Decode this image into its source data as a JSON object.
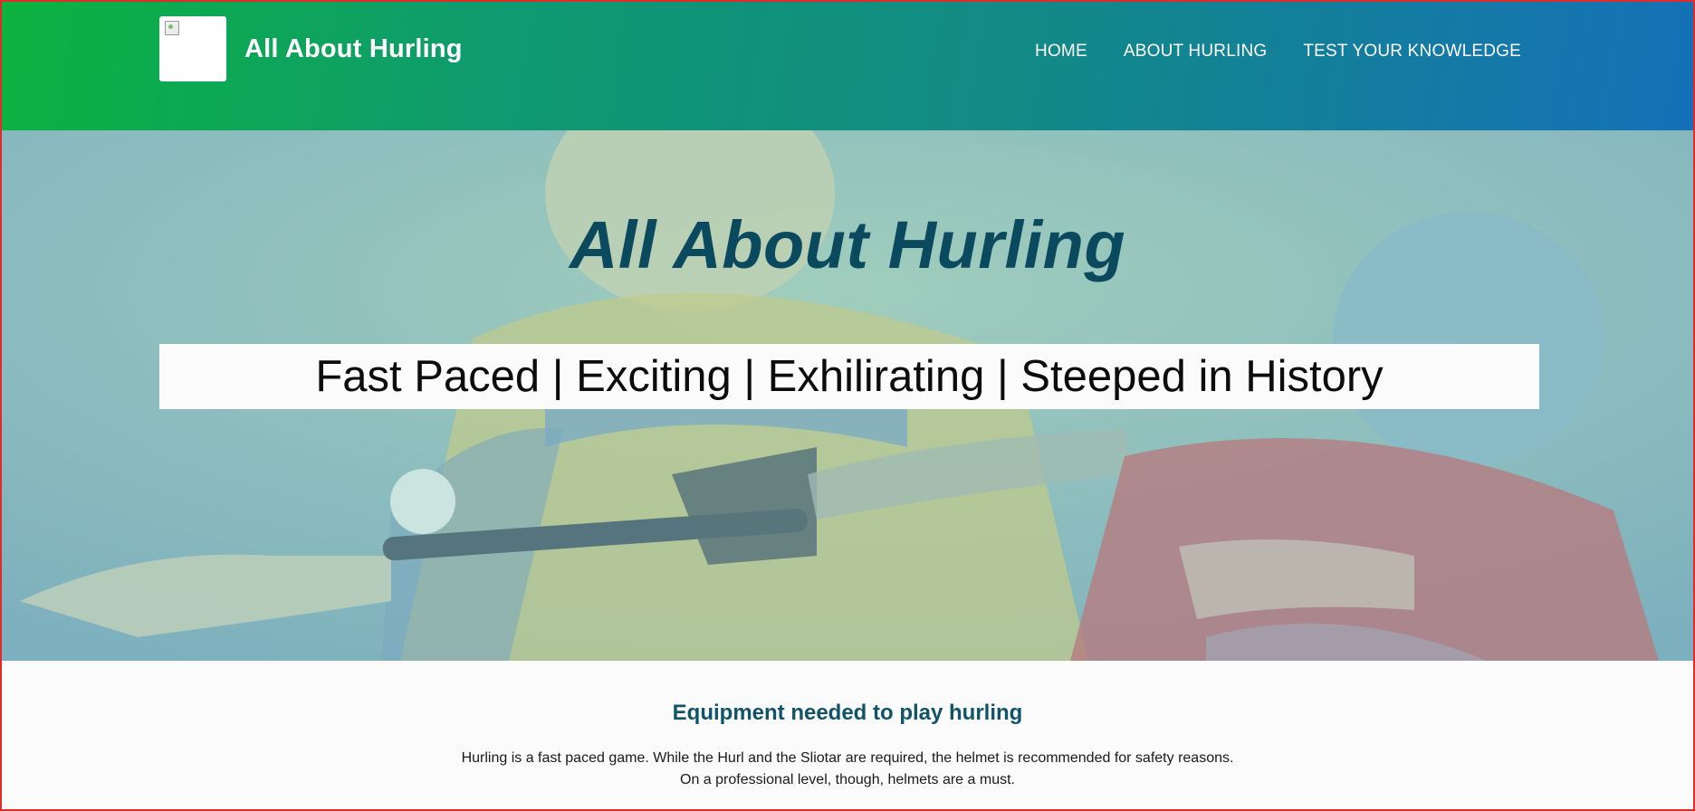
{
  "header": {
    "brand_title": "All About Hurling",
    "logo_icon": "broken-image-icon",
    "nav": [
      {
        "label": "HOME"
      },
      {
        "label": "ABOUT HURLING"
      },
      {
        "label": "TEST YOUR KNOWLEDGE"
      }
    ],
    "gradient_colors": [
      "#0bb33f",
      "#128a86",
      "#1570b8"
    ]
  },
  "hero": {
    "title": "All About Hurling",
    "tagline": "Fast Paced | Exciting | Exhilirating | Steeped in History",
    "title_color": "#0b4a5e"
  },
  "section": {
    "title": "Equipment needed to play hurling",
    "line1": "Hurling is a fast paced game. While the Hurl and the Sliotar are required, the helmet is recommended for safety reasons.",
    "line2": "On a professional level, though, helmets are a must."
  }
}
